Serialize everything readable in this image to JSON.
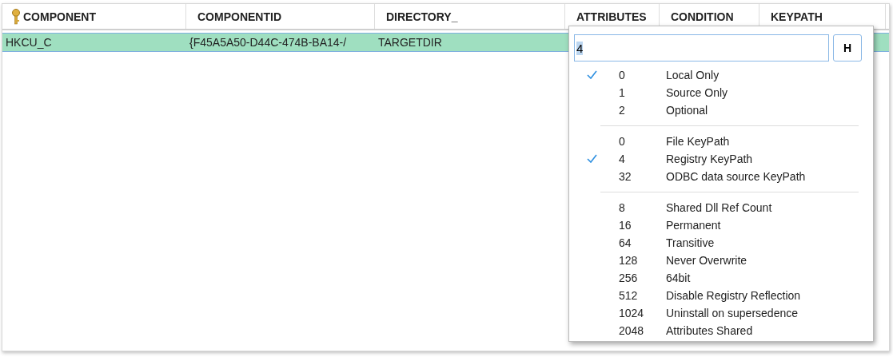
{
  "table": {
    "columns": [
      {
        "label": "COMPONENT",
        "key": true
      },
      {
        "label": "COMPONENTID",
        "key": false
      },
      {
        "label": "DIRECTORY_",
        "key": false
      },
      {
        "label": "ATTRIBUTES",
        "key": false
      },
      {
        "label": "CONDITION",
        "key": false
      },
      {
        "label": "KEYPATH",
        "key": false
      }
    ],
    "rows": [
      {
        "selected": true,
        "cells": [
          "HKCU_C",
          "{F45A5A50-D44C-474B-BA14-/",
          "TARGETDIR"
        ]
      }
    ]
  },
  "popup": {
    "value": "4",
    "button": "H",
    "groups": [
      [
        {
          "value": "0",
          "label": "Local Only",
          "checked": true
        },
        {
          "value": "1",
          "label": "Source Only",
          "checked": false
        },
        {
          "value": "2",
          "label": "Optional",
          "checked": false
        }
      ],
      [
        {
          "value": "0",
          "label": "File KeyPath",
          "checked": false
        },
        {
          "value": "4",
          "label": "Registry KeyPath",
          "checked": true
        },
        {
          "value": "32",
          "label": "ODBC data source KeyPath",
          "checked": false
        }
      ],
      [
        {
          "value": "8",
          "label": "Shared Dll Ref Count",
          "checked": false
        },
        {
          "value": "16",
          "label": "Permanent",
          "checked": false
        },
        {
          "value": "64",
          "label": "Transitive",
          "checked": false
        },
        {
          "value": "128",
          "label": "Never Overwrite",
          "checked": false
        },
        {
          "value": "256",
          "label": "64bit",
          "checked": false
        },
        {
          "value": "512",
          "label": "Disable Registry Reflection",
          "checked": false
        },
        {
          "value": "1024",
          "label": "Uninstall on supersedence",
          "checked": false
        },
        {
          "value": "2048",
          "label": "Attributes Shared",
          "checked": false
        }
      ]
    ]
  }
}
